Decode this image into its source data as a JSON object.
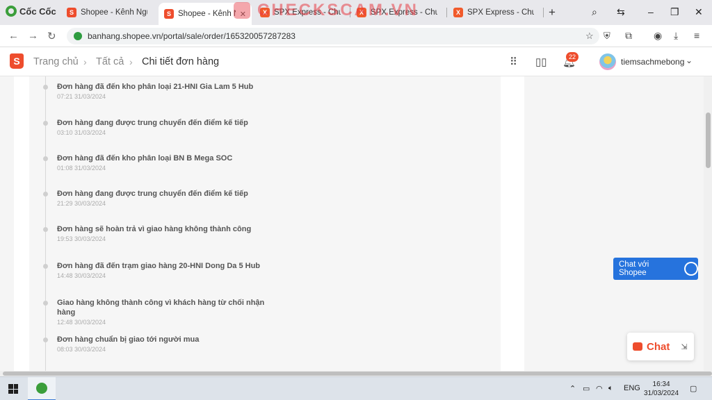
{
  "browser": {
    "brand": "Cốc Cốc",
    "tabs": [
      {
        "title": "Shopee - Kênh Người B",
        "icon": "shopee-icon",
        "active": false
      },
      {
        "title": "Shopee - Kênh N",
        "icon": "shopee-icon",
        "active": true
      },
      {
        "title": "SPX Express - Chuyển",
        "icon": "spx-icon",
        "active": false
      },
      {
        "title": "SPX Express - Chuyển",
        "icon": "spx-icon",
        "active": false
      },
      {
        "title": "SPX Express - Chuyển I",
        "icon": "spx-icon",
        "active": false
      }
    ],
    "watermark": "CHECKSCAM.VN",
    "url": "banhang.shopee.vn/portal/sale/order/165320057287283"
  },
  "header": {
    "breadcrumb": [
      "Trang chủ",
      "Tất cả",
      "Chi tiết đơn hàng"
    ],
    "notification_count": "22",
    "shop_name": "tiemsachmebong"
  },
  "timeline": [
    {
      "text": "Đơn hàng đã đến kho phân loại 21-HNI Gia Lam 5 Hub",
      "time": "07:21 31/03/2024"
    },
    {
      "text": "Đơn hàng đang được trung chuyển đến điểm kế tiếp",
      "time": "03:10 31/03/2024"
    },
    {
      "text": "Đơn hàng đã đến kho phân loại BN B Mega SOC",
      "time": "01:08 31/03/2024"
    },
    {
      "text": "Đơn hàng đang được trung chuyển đến điểm kế tiếp",
      "time": "21:29 30/03/2024"
    },
    {
      "text": "Đơn hàng sẽ hoàn trả vì giao hàng không thành công",
      "time": "19:53 30/03/2024"
    },
    {
      "text": "Đơn hàng đã đến trạm giao hàng 20-HNI Dong Da 5 Hub",
      "time": "14:48 30/03/2024"
    },
    {
      "text": "Giao hàng không thành công vì khách hàng từ chối nhận hàng",
      "time": "12:48 30/03/2024"
    },
    {
      "text": "Đơn hàng chuẩn bị giao tới người mua",
      "time": "08:03 30/03/2024"
    }
  ],
  "chat_with_shopee": "Chat với Shopee",
  "chat_label": "Chat",
  "taskbar": {
    "language": "ENG",
    "time": "16:34",
    "date": "31/03/2024"
  },
  "colors": {
    "shopee_orange": "#ee4d2d",
    "chat_blue": "#2673dd"
  }
}
